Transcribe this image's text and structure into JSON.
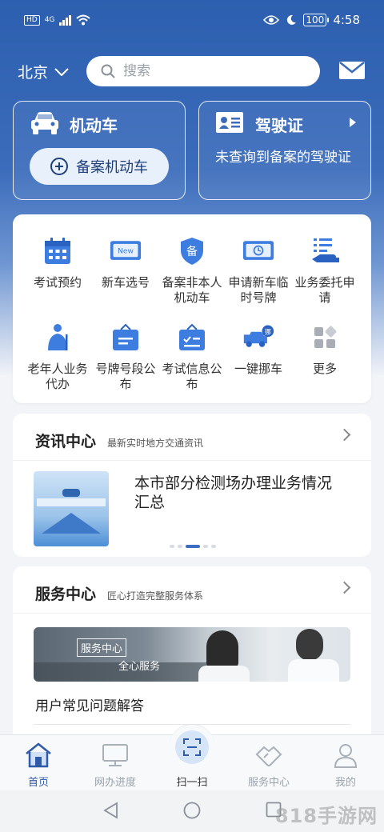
{
  "status_bar": {
    "hd": "HD",
    "network": "4G",
    "battery": "100",
    "time": "4:58"
  },
  "header": {
    "city": "北京",
    "search_placeholder": "搜索"
  },
  "vehicle_card": {
    "title": "机动车",
    "button": "备案机动车"
  },
  "license_card": {
    "title": "驾驶证",
    "text": "未查询到备案的驾驶证"
  },
  "services": [
    {
      "label": "考试预约",
      "icon": "calendar-icon"
    },
    {
      "label": "新车选号",
      "icon": "new-plate-icon"
    },
    {
      "label": "备案非本人机动车",
      "icon": "shield-bei-icon"
    },
    {
      "label": "申请新车临时号牌",
      "icon": "temp-plate-icon"
    },
    {
      "label": "业务委托申请",
      "icon": "delegate-icon"
    },
    {
      "label": "老年人业务代办",
      "icon": "elderly-icon"
    },
    {
      "label": "号牌号段公布",
      "icon": "plate-range-icon"
    },
    {
      "label": "考试信息公布",
      "icon": "exam-info-icon"
    },
    {
      "label": "一键挪车",
      "icon": "move-car-icon"
    },
    {
      "label": "更多",
      "icon": "more-grid-icon"
    }
  ],
  "news": {
    "title": "资讯中心",
    "subtitle": "最新实时地方交通资讯",
    "headline": "本市部分检测场办理业务情况汇总"
  },
  "service_center": {
    "title": "服务中心",
    "subtitle": "匠心打造完整服务体系",
    "banner_tag": "服务中心",
    "banner_text": "全心服务",
    "link": "用户常见问题解答"
  },
  "tabs": [
    {
      "label": "首页",
      "icon": "home-icon",
      "active": true
    },
    {
      "label": "网办进度",
      "icon": "monitor-icon",
      "active": false
    },
    {
      "label": "扫一扫",
      "icon": "scan-icon",
      "active": false
    },
    {
      "label": "服务中心",
      "icon": "handshake-icon",
      "active": false
    },
    {
      "label": "我的",
      "icon": "user-icon",
      "active": false
    }
  ],
  "watermark": "818手游网",
  "colors": {
    "brand_blue": "#2d5fb0",
    "active_tab": "#2f5aa8",
    "icon_blue": "#3d7de0"
  }
}
